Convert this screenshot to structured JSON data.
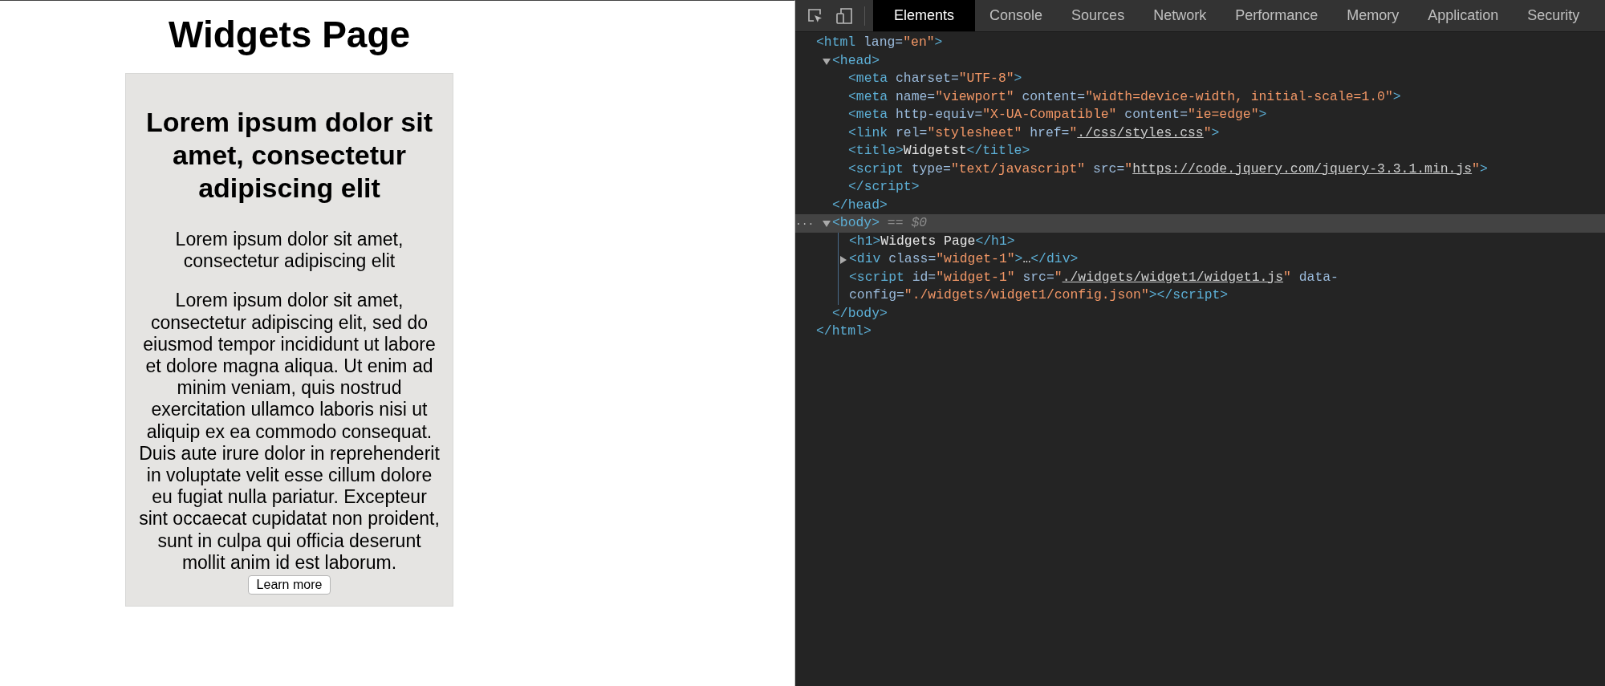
{
  "page": {
    "heading": "Widgets Page",
    "card": {
      "title": "Lorem ipsum dolor sit amet, consectetur adipiscing elit",
      "paragraphs": [
        "Lorem ipsum dolor sit amet, consectetur adipiscing elit",
        "Lorem ipsum dolor sit amet, consectetur adipiscing elit, sed do eiusmod tempor incididunt ut labore et dolore magna aliqua. Ut enim ad minim veniam, quis nostrud exercitation ullamco laboris nisi ut aliquip ex ea commodo consequat. Duis aute irure dolor in reprehenderit in voluptate velit esse cillum dolore eu fugiat nulla pariatur. Excepteur sint occaecat cupidatat non proident, sunt in culpa qui officia deserunt mollit anim id est laborum."
      ],
      "button": "Learn more"
    }
  },
  "devtools": {
    "tabs": [
      {
        "label": "Elements",
        "selected": true
      },
      {
        "label": "Console",
        "selected": false
      },
      {
        "label": "Sources",
        "selected": false
      },
      {
        "label": "Network",
        "selected": false
      },
      {
        "label": "Performance",
        "selected": false
      },
      {
        "label": "Memory",
        "selected": false
      },
      {
        "label": "Application",
        "selected": false
      },
      {
        "label": "Security",
        "selected": false
      }
    ],
    "dom_tree": [
      {
        "selected": false,
        "tokens": [
          {
            "kind": "tag",
            "text": "<html"
          },
          {
            "kind": "attr",
            "text": " lang="
          },
          {
            "kind": "val",
            "text": "\"en\""
          },
          {
            "kind": "tag",
            "text": ">"
          }
        ],
        "close": [
          {
            "kind": "tag",
            "text": "</html>"
          }
        ],
        "children": [
          {
            "selected": false,
            "expanded": true,
            "tokens": [
              {
                "kind": "tag",
                "text": "<head>"
              }
            ],
            "close": [
              {
                "kind": "tag",
                "text": "</head>"
              }
            ],
            "children": [
              {
                "selected": false,
                "tokens": [
                  {
                    "kind": "tag",
                    "text": "<meta"
                  },
                  {
                    "kind": "attr",
                    "text": " charset="
                  },
                  {
                    "kind": "val",
                    "text": "\"UTF-8\""
                  },
                  {
                    "kind": "tag",
                    "text": ">"
                  }
                ]
              },
              {
                "selected": false,
                "tokens": [
                  {
                    "kind": "tag",
                    "text": "<meta"
                  },
                  {
                    "kind": "attr",
                    "text": " name="
                  },
                  {
                    "kind": "val",
                    "text": "\"viewport\""
                  },
                  {
                    "kind": "attr",
                    "text": " content="
                  },
                  {
                    "kind": "val",
                    "text": "\"width=device-width, initial-scale=1.0\""
                  },
                  {
                    "kind": "tag",
                    "text": ">"
                  }
                ]
              },
              {
                "selected": false,
                "tokens": [
                  {
                    "kind": "tag",
                    "text": "<meta"
                  },
                  {
                    "kind": "attr",
                    "text": " http-equiv="
                  },
                  {
                    "kind": "val",
                    "text": "\"X-UA-Compatible\""
                  },
                  {
                    "kind": "attr",
                    "text": " content="
                  },
                  {
                    "kind": "val",
                    "text": "\"ie=edge\""
                  },
                  {
                    "kind": "tag",
                    "text": ">"
                  }
                ]
              },
              {
                "selected": false,
                "tokens": [
                  {
                    "kind": "tag",
                    "text": "<link"
                  },
                  {
                    "kind": "attr",
                    "text": " rel="
                  },
                  {
                    "kind": "val",
                    "text": "\"stylesheet\""
                  },
                  {
                    "kind": "attr",
                    "text": " href="
                  },
                  {
                    "kind": "val",
                    "text": "\""
                  },
                  {
                    "kind": "link",
                    "text": "./css/styles.css"
                  },
                  {
                    "kind": "val",
                    "text": "\""
                  },
                  {
                    "kind": "tag",
                    "text": ">"
                  }
                ]
              },
              {
                "selected": false,
                "tokens": [
                  {
                    "kind": "tag",
                    "text": "<title>"
                  },
                  {
                    "kind": "text",
                    "text": "Widgetst"
                  },
                  {
                    "kind": "tag",
                    "text": "</title>"
                  }
                ]
              },
              {
                "selected": false,
                "tokens": [
                  {
                    "kind": "tag",
                    "text": "<script"
                  },
                  {
                    "kind": "attr",
                    "text": " type="
                  },
                  {
                    "kind": "val",
                    "text": "\"text/javascript\""
                  },
                  {
                    "kind": "attr",
                    "text": " src="
                  },
                  {
                    "kind": "val",
                    "text": "\""
                  },
                  {
                    "kind": "link",
                    "text": "https://code.jquery.com/jquery-3.3.1.min.js"
                  },
                  {
                    "kind": "val",
                    "text": "\""
                  },
                  {
                    "kind": "tag",
                    "text": "></script>"
                  }
                ]
              }
            ]
          },
          {
            "selected": true,
            "expanded": true,
            "gutter": "...",
            "tokens": [
              {
                "kind": "tag",
                "text": "<body>"
              },
              {
                "kind": "marker",
                "text": " == $0"
              }
            ],
            "close": [
              {
                "kind": "tag",
                "text": "</body>"
              }
            ],
            "children": [
              {
                "selected": false,
                "tokens": [
                  {
                    "kind": "tag",
                    "text": "<h1>"
                  },
                  {
                    "kind": "text",
                    "text": "Widgets Page"
                  },
                  {
                    "kind": "tag",
                    "text": "</h1>"
                  }
                ]
              },
              {
                "selected": false,
                "expanded": false,
                "tokens": [
                  {
                    "kind": "tag",
                    "text": "<div"
                  },
                  {
                    "kind": "attr",
                    "text": " class="
                  },
                  {
                    "kind": "val",
                    "text": "\"widget-1\""
                  },
                  {
                    "kind": "tag",
                    "text": ">"
                  },
                  {
                    "kind": "text",
                    "text": "…"
                  },
                  {
                    "kind": "tag",
                    "text": "</div>"
                  }
                ]
              },
              {
                "selected": false,
                "tokens": [
                  {
                    "kind": "tag",
                    "text": "<script"
                  },
                  {
                    "kind": "attr",
                    "text": " id="
                  },
                  {
                    "kind": "val",
                    "text": "\"widget-1\""
                  },
                  {
                    "kind": "attr",
                    "text": " src="
                  },
                  {
                    "kind": "val",
                    "text": "\""
                  },
                  {
                    "kind": "link",
                    "text": "./widgets/widget1/widget1.js"
                  },
                  {
                    "kind": "val",
                    "text": "\""
                  },
                  {
                    "kind": "attr",
                    "text": " data-config="
                  },
                  {
                    "kind": "val",
                    "text": "\"./widgets/widget1/config.json\""
                  },
                  {
                    "kind": "tag",
                    "text": "></script>"
                  }
                ]
              }
            ]
          }
        ]
      }
    ]
  }
}
